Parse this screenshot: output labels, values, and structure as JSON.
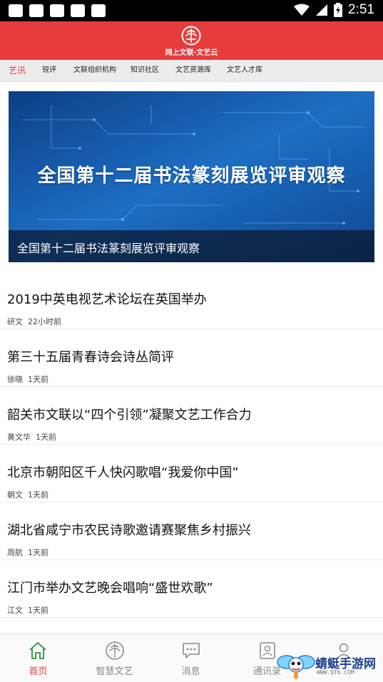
{
  "status_bar": {
    "time": "2:51"
  },
  "header": {
    "title": "网上文联·文艺云"
  },
  "tabs": [
    {
      "label": "艺讯",
      "active": true
    },
    {
      "label": "锐评"
    },
    {
      "label": "文联组织机构"
    },
    {
      "label": "知识社区"
    },
    {
      "label": "文艺资源库"
    },
    {
      "label": "文艺人才库"
    }
  ],
  "banner": {
    "headline": "全国第十二届书法篆刻展览评审观察",
    "caption": "全国第十二届书法篆刻展览评审观察"
  },
  "news": [
    {
      "title": "2019中英电视艺术论坛在英国举办",
      "author": "研文",
      "time": "22小时前"
    },
    {
      "title": "第三十五届青春诗会诗丛简评",
      "author": "徐晓",
      "time": "1天前"
    },
    {
      "title": "韶关市文联以“四个引领”凝聚文艺工作合力",
      "author": "黄文华",
      "time": "1天前"
    },
    {
      "title": "北京市朝阳区千人快闪歌唱“我爱你中国”",
      "author": "朝文",
      "time": "1天前"
    },
    {
      "title": "湖北省咸宁市农民诗歌邀请赛聚焦乡村振兴",
      "author": "周航",
      "time": "1天前"
    },
    {
      "title": "江门市举办文艺晚会唱响“盛世欢歌”",
      "author": "江文",
      "time": "1天前"
    }
  ],
  "bottom_nav": [
    {
      "label": "首页",
      "icon": "home-icon",
      "active": true
    },
    {
      "label": "智慧文艺",
      "icon": "emblem-icon"
    },
    {
      "label": "消息",
      "icon": "message-icon"
    },
    {
      "label": "通讯录",
      "icon": "contacts-icon"
    },
    {
      "label": "",
      "icon": "profile-icon"
    }
  ],
  "watermark": {
    "text": "蜻蜓手游网",
    "url": "WWW.QT6.COM"
  },
  "colors": {
    "brand_red": "#e83c3c",
    "tab_bar": "#ececec",
    "banner_blue": "#1657a0",
    "nav_inactive": "#888888"
  }
}
